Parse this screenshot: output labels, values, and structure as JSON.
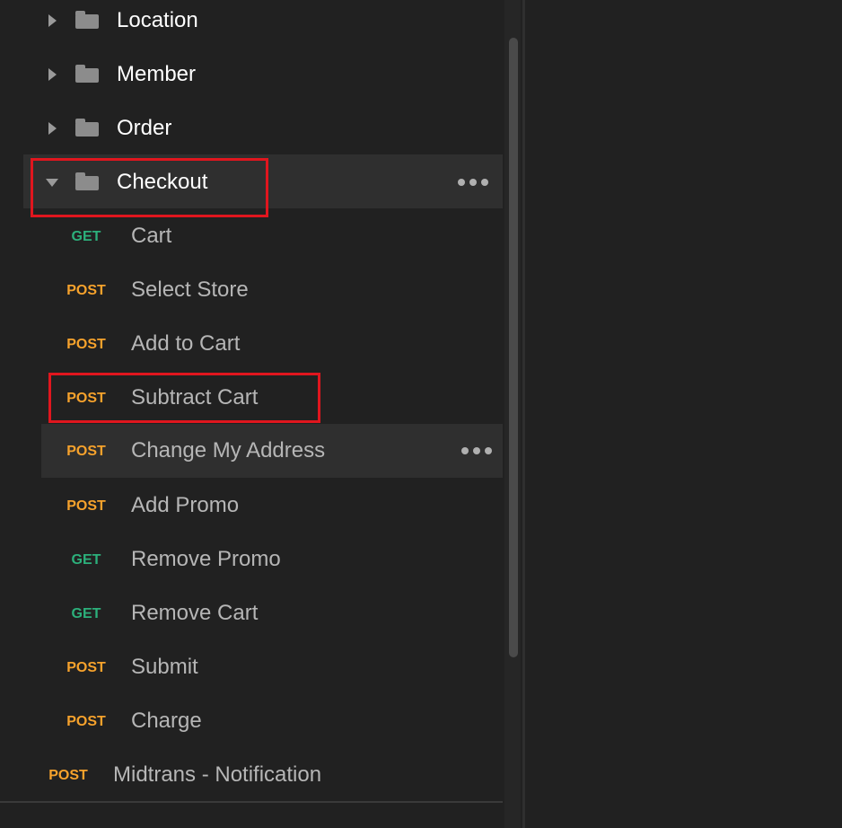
{
  "colors": {
    "background": "#212121",
    "get": "#2cb07b",
    "post": "#f6a22c",
    "annotation": "#e0161e"
  },
  "folders": [
    {
      "label": "Location",
      "icon": "folder-icon",
      "caret": "caret-right-icon"
    },
    {
      "label": "Member",
      "icon": "folder-icon",
      "caret": "caret-right-icon"
    },
    {
      "label": "Order",
      "icon": "folder-icon",
      "caret": "caret-right-icon"
    },
    {
      "label": "Checkout",
      "icon": "folder-icon",
      "caret": "caret-down-icon",
      "expanded": true
    }
  ],
  "checkout_requests": [
    {
      "method": "GET",
      "label": "Cart"
    },
    {
      "method": "POST",
      "label": "Select Store"
    },
    {
      "method": "POST",
      "label": "Add to Cart"
    },
    {
      "method": "POST",
      "label": "Subtract Cart"
    },
    {
      "method": "POST",
      "label": "Change My Address"
    },
    {
      "method": "POST",
      "label": "Add Promo"
    },
    {
      "method": "GET",
      "label": "Remove Promo"
    },
    {
      "method": "GET",
      "label": "Remove Cart"
    },
    {
      "method": "POST",
      "label": "Submit"
    },
    {
      "method": "POST",
      "label": "Charge"
    }
  ],
  "root_requests": [
    {
      "method": "POST",
      "label": "Midtrans - Notification"
    }
  ],
  "icons": {
    "more": "more-horizontal-icon"
  }
}
